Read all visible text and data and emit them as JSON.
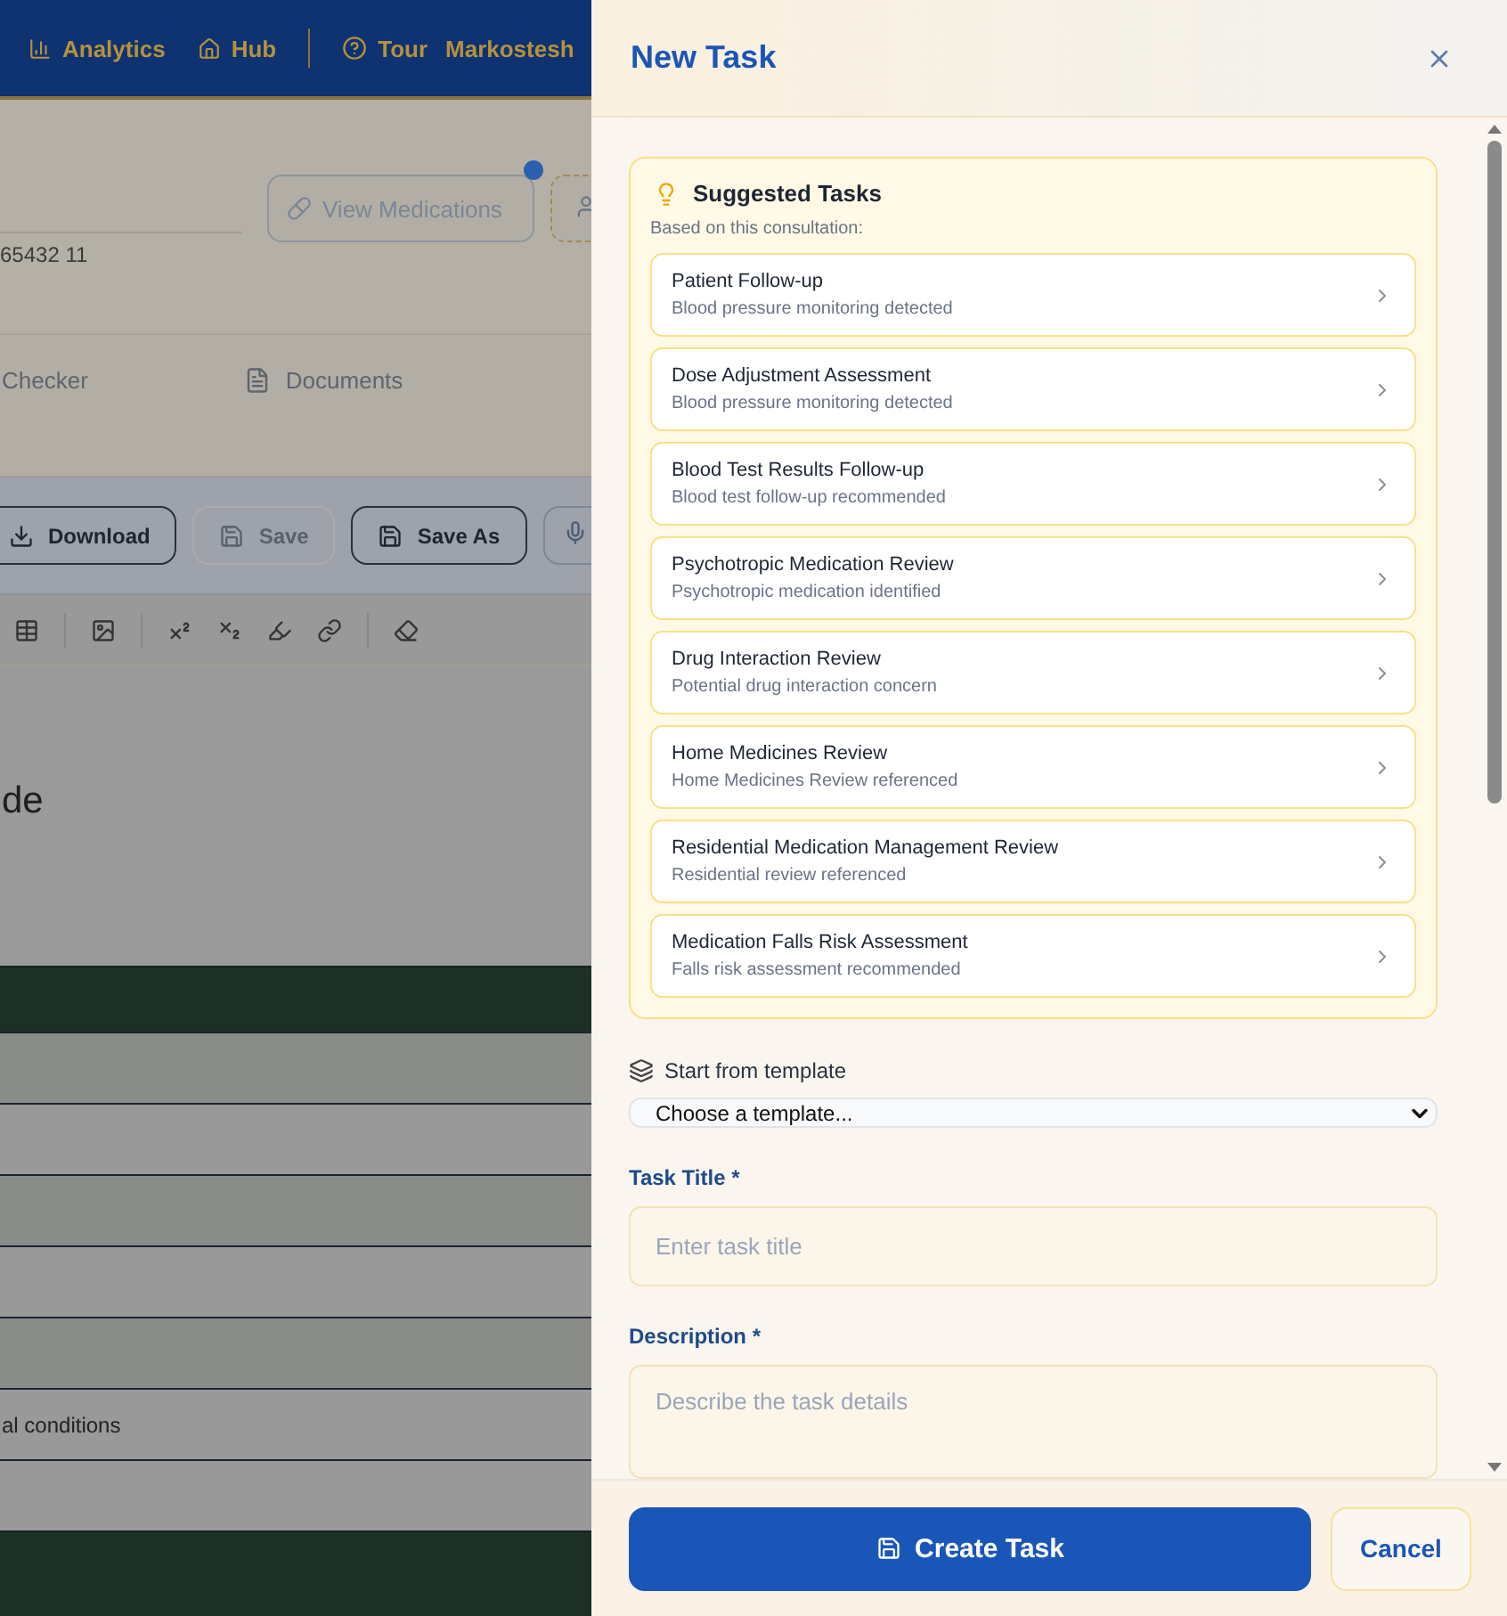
{
  "nav": {
    "items": [
      {
        "label": "Analytics"
      },
      {
        "label": "Hub"
      },
      {
        "label": "Tour"
      }
    ],
    "user": "Markostesh"
  },
  "header": {
    "button": "View Medications",
    "reference": "65432 11"
  },
  "tabs": [
    {
      "label": "Checker"
    },
    {
      "label": "Documents"
    }
  ],
  "actions": [
    {
      "label": "Download",
      "disabled": false
    },
    {
      "label": "Save",
      "disabled": true
    },
    {
      "label": "Save As",
      "disabled": false
    }
  ],
  "document": {
    "heading": "de",
    "table_text": "al conditions"
  },
  "drawer": {
    "title": "New Task",
    "suggestions": {
      "title": "Suggested Tasks",
      "subtitle": "Based on this consultation:",
      "items": [
        {
          "title": "Patient Follow-up",
          "reason": "Blood pressure monitoring detected"
        },
        {
          "title": "Dose Adjustment Assessment",
          "reason": "Blood pressure monitoring detected"
        },
        {
          "title": "Blood Test Results Follow-up",
          "reason": "Blood test follow-up recommended"
        },
        {
          "title": "Psychotropic Medication Review",
          "reason": "Psychotropic medication identified"
        },
        {
          "title": "Drug Interaction Review",
          "reason": "Potential drug interaction concern"
        },
        {
          "title": "Home Medicines Review",
          "reason": "Home Medicines Review referenced"
        },
        {
          "title": "Residential Medication Management Review",
          "reason": "Residential review referenced"
        },
        {
          "title": "Medication Falls Risk Assessment",
          "reason": "Falls risk assessment recommended"
        }
      ]
    },
    "template": {
      "label": "Start from template",
      "placeholder": "Choose a template..."
    },
    "fields": [
      {
        "label": "Task Title *",
        "placeholder": "Enter task title",
        "kind": "input"
      },
      {
        "label": "Description *",
        "placeholder": "Describe the task details",
        "kind": "textarea"
      }
    ],
    "primary": "Create Task",
    "secondary": "Cancel"
  }
}
